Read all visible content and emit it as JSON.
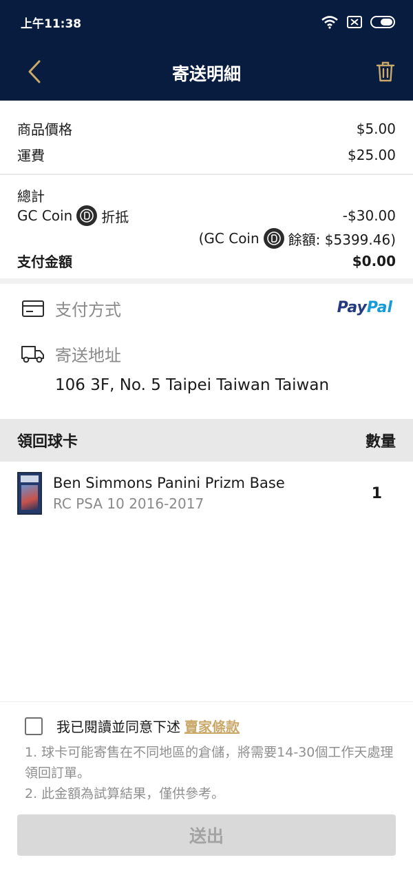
{
  "status_bar": {
    "time": "上午11:38"
  },
  "nav": {
    "title": "寄送明細"
  },
  "price": {
    "item_label": "商品價格",
    "item_value": "$5.00",
    "shipping_label": "運費",
    "shipping_value": "$25.00"
  },
  "summary": {
    "total_label": "總計",
    "coin_label": "GC Coin",
    "coin_action": "折抵",
    "coin_discount": "-$30.00",
    "balance_prefix": "(GC Coin",
    "balance_text": "餘額: $5399.46)",
    "pay_label": "支付金額",
    "pay_value": "$0.00"
  },
  "payment": {
    "label": "支付方式",
    "provider_part1": "Pay",
    "provider_part2": "Pal",
    "colors": {
      "pay": "#253b80",
      "pal": "#179bd7"
    }
  },
  "shipping": {
    "label": "寄送地址",
    "address": "106 3F, No. 5 Taipei Taiwan Taiwan"
  },
  "cards": {
    "header_left": "領回球卡",
    "header_right": "數量",
    "items": [
      {
        "name": "Ben Simmons Panini Prizm Base",
        "sub": "RC PSA 10 2016-2017",
        "qty": "1"
      }
    ]
  },
  "footer": {
    "agree_text": "我已閱讀並同意下述",
    "terms_link": "賣家條款",
    "note1": "1. 球卡可能寄售在不同地區的倉儲，將需要14-30個工作天處理領回訂單。",
    "note2": "2. 此金額為試算結果，僅供參考。",
    "submit": "送出"
  },
  "colors": {
    "header_bg": "#081c3f",
    "accent_gold": "#c9a86a",
    "submit_disabled_bg": "#d9d9d9"
  },
  "icons": [
    "back-chevron-icon",
    "trash-icon",
    "wifi-icon",
    "sim-icon",
    "battery-icon",
    "coin-icon",
    "card-icon",
    "truck-icon",
    "checkbox-icon"
  ]
}
